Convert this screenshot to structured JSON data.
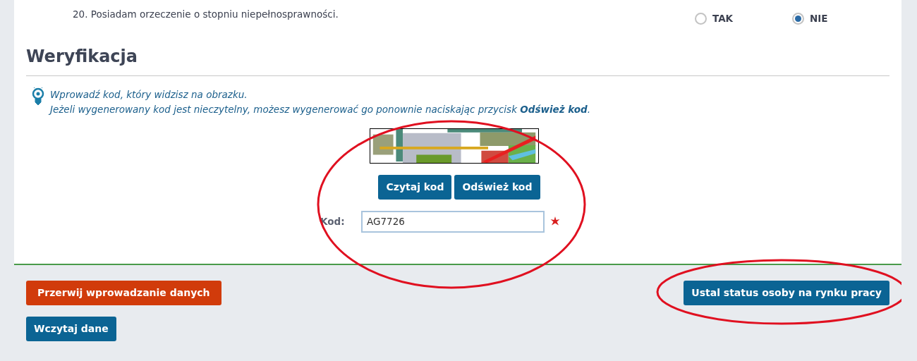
{
  "question": {
    "text": "20. Posiadam orzeczenie o stopniu niepełnosprawności.",
    "options": [
      {
        "label": "TAK",
        "selected": false
      },
      {
        "label": "NIE",
        "selected": true
      }
    ]
  },
  "section": {
    "title": "Weryfikacja",
    "hint_lines": [
      "Wprowadź kod, który widzisz na obrazku.",
      "Jeżeli wygenerowany kod jest nieczytelny, możesz wygenerować go ponownie naciskając przycisk **Odśwież kod**."
    ],
    "captcha": {
      "kind": "picture"
    },
    "captcha_buttons": [
      "Czytaj kod",
      "Odśwież kod"
    ],
    "code_field": {
      "label": "Kod:",
      "value": "AG7726",
      "required": true
    }
  },
  "footer": {
    "buttons": [
      {
        "label": "Przerwij wprowadzanie danych",
        "kind": "danger"
      },
      {
        "label": "Ustal status osoby na rynku pracy",
        "kind": "primary"
      },
      {
        "label": "Wczytaj dane",
        "kind": "primary"
      }
    ]
  },
  "annotations": [
    {
      "kind": "ellipse"
    },
    {
      "kind": "ellipse"
    }
  ]
}
